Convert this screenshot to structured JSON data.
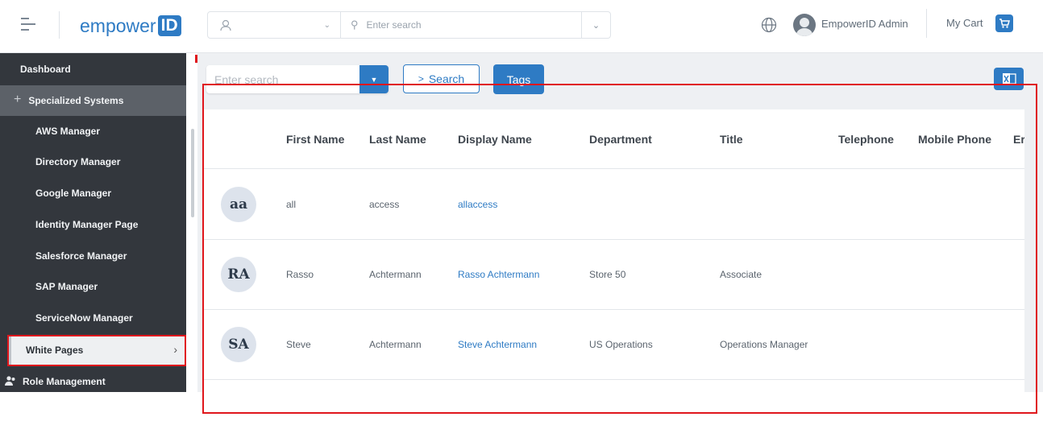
{
  "header": {
    "logo_text": "empower",
    "logo_id": "ID",
    "search_scope_icon": "person-icon",
    "search_placeholder": "Enter search",
    "user_name": "EmpowerID Admin",
    "cart_label": "My Cart"
  },
  "sidebar": {
    "dashboard": "Dashboard",
    "section": "Specialized Systems",
    "section_icon": "+",
    "items": [
      {
        "label": "AWS Manager"
      },
      {
        "label": "Directory Manager"
      },
      {
        "label": "Google Manager"
      },
      {
        "label": "Identity Manager Page"
      },
      {
        "label": "Salesforce Manager"
      },
      {
        "label": "SAP Manager"
      },
      {
        "label": "ServiceNow Manager"
      }
    ],
    "selected": "White Pages",
    "selected_chevron": "›",
    "role": "Role Management"
  },
  "toolbar": {
    "search_placeholder": "Enter search",
    "search_button": "Search",
    "search_arrow": ">",
    "tags_button": "Tags"
  },
  "table": {
    "columns": [
      "First Name",
      "Last Name",
      "Display Name",
      "Department",
      "Title",
      "Telephone",
      "Mobile Phone",
      "Er"
    ],
    "rows": [
      {
        "initials": "aa",
        "first": "all",
        "last": "access",
        "display": "allaccess",
        "department": "",
        "title": ""
      },
      {
        "initials": "RA",
        "first": "Rasso",
        "last": "Achtermann",
        "display": "Rasso Achtermann",
        "department": "Store 50",
        "title": "Associate"
      },
      {
        "initials": "SA",
        "first": "Steve",
        "last": "Achtermann",
        "display": "Steve Achtermann",
        "department": "US Operations",
        "title": "Operations Manager"
      }
    ]
  },
  "colors": {
    "accent": "#2e7bc4",
    "sidebar_bg": "#33373d",
    "highlight": "#e0161c"
  }
}
